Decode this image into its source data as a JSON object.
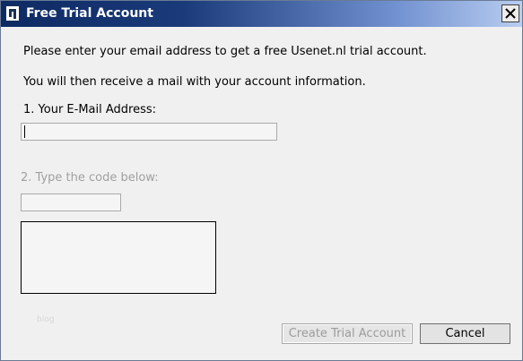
{
  "window": {
    "title": "Free Trial Account",
    "close_label": "×"
  },
  "intro": {
    "line1": "Please enter your email address to get a free Usenet.nl trial account.",
    "line2": "You will then receive a mail with your account information."
  },
  "email": {
    "label": "1. Your E-Mail Address:",
    "value": "",
    "placeholder": ""
  },
  "code": {
    "label": "2. Type the code below:",
    "value": "",
    "placeholder": ""
  },
  "footer": {
    "link_text": "blog"
  },
  "buttons": {
    "create_label": "Create Trial Account",
    "cancel_label": "Cancel"
  },
  "colors": {
    "titlebar_start": "#0e2a63",
    "titlebar_end": "#b8cdf0",
    "disabled_text": "#a0a0a0"
  }
}
